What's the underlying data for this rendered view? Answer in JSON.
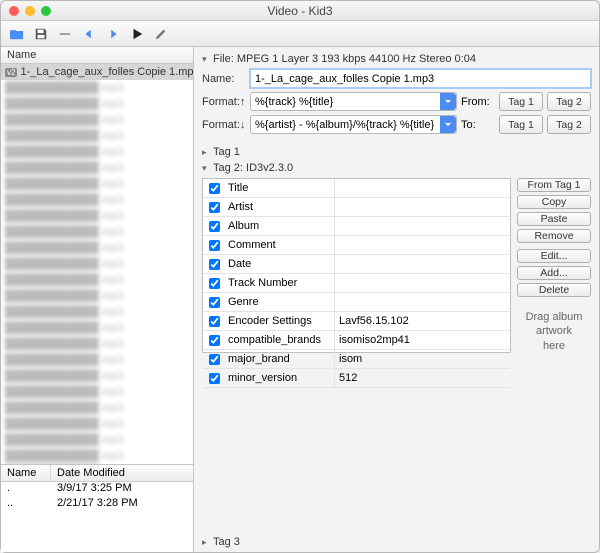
{
  "window": {
    "title": "Video - Kid3"
  },
  "left": {
    "header": "Name",
    "selected_badge": "v2",
    "selected": "1-_La_cage_aux_folles Copie 1.mp3",
    "blurred_count": 28
  },
  "bottom": {
    "col1": "Name",
    "col2": "Date Modified",
    "rows": [
      {
        "name": ".",
        "date": "3/9/17 3:25 PM"
      },
      {
        "name": "..",
        "date": "2/21/17 3:28 PM"
      }
    ]
  },
  "right": {
    "file_label": "File:",
    "file_info": "MPEG 1 Layer 3 193 kbps 44100 Hz Stereo 0:04",
    "name_label": "Name:",
    "name_value": "1-_La_cage_aux_folles Copie 1.mp3",
    "format_up_label": "Format:↑",
    "format_up_value": "%{track} %{title}",
    "format_dn_label": "Format:↓",
    "format_dn_value": "%{artist} - %{album}/%{track} %{title}",
    "from_label": "From:",
    "to_label": "To:",
    "tag1_btn": "Tag 1",
    "tag2_btn": "Tag 2",
    "tag1_section": "Tag 1",
    "tag2_section": "Tag 2: ID3v2.3.0",
    "tag3_section": "Tag 3",
    "buttons": {
      "from_tag1": "From Tag 1",
      "copy": "Copy",
      "paste": "Paste",
      "remove": "Remove",
      "edit": "Edit...",
      "add": "Add...",
      "delete": "Delete"
    },
    "drag_hint": "Drag album\nartwork\nhere",
    "fields": [
      {
        "name": "Title",
        "value": ""
      },
      {
        "name": "Artist",
        "value": ""
      },
      {
        "name": "Album",
        "value": ""
      },
      {
        "name": "Comment",
        "value": ""
      },
      {
        "name": "Date",
        "value": ""
      },
      {
        "name": "Track Number",
        "value": ""
      },
      {
        "name": "Genre",
        "value": ""
      },
      {
        "name": "Encoder Settings",
        "value": "Lavf56.15.102"
      },
      {
        "name": "compatible_brands",
        "value": "isomiso2mp41"
      },
      {
        "name": "major_brand",
        "value": "isom"
      },
      {
        "name": "minor_version",
        "value": "512"
      }
    ]
  }
}
